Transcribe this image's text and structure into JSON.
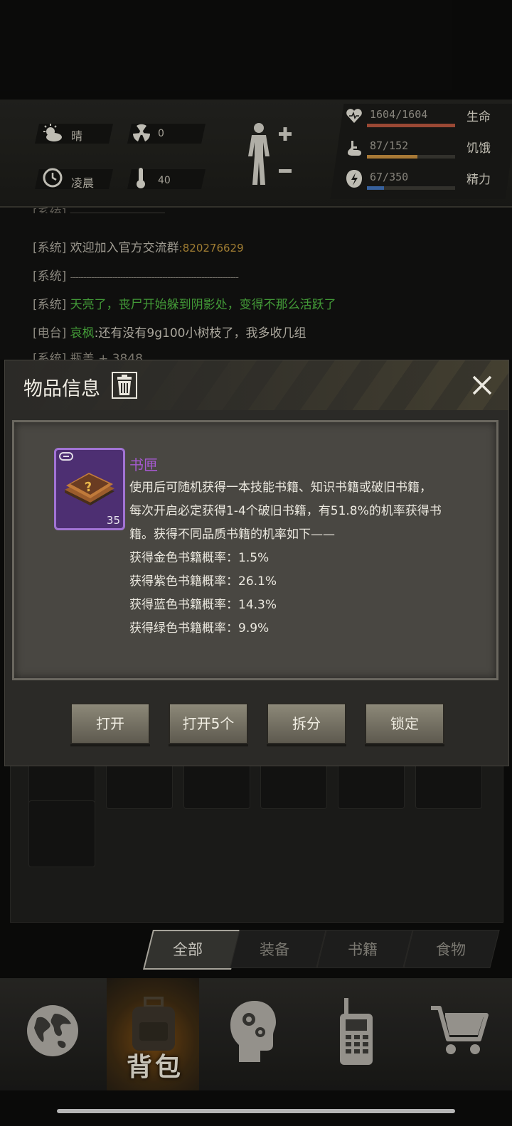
{
  "status": {
    "weather": "晴",
    "radiation": "0",
    "time_of_day": "凌晨",
    "temperature": "40",
    "stats": [
      {
        "label": "生命",
        "value": "1604/1604",
        "fill": 1.0,
        "color": "#b0533c"
      },
      {
        "label": "饥饿",
        "value": "87/152",
        "fill": 0.57,
        "color": "#c08a3e"
      },
      {
        "label": "精力",
        "value": "67/350",
        "fill": 0.19,
        "color": "#3f6fb3"
      }
    ]
  },
  "chat": [
    {
      "channel": "[系统]",
      "text": "欢迎加入官方交流群",
      "extra": ":820276629",
      "color": "#a9a59a",
      "extra_color": "#b78f3a"
    },
    {
      "channel": "[系统]",
      "text": "----------------------------------------------------------------",
      "extra": "",
      "color": "#8c897f",
      "extra_color": ""
    },
    {
      "channel": "[系统]",
      "text": "天亮了，丧尸开始躲到阴影处，变得不那么活跃了",
      "extra": "",
      "color": "#4caf3f",
      "extra_color": ""
    },
    {
      "channel": "[电台]",
      "speaker": "哀枫",
      "text": ":还有没有9g100小树枝了，我多收几组",
      "extra": "",
      "color": "#c3bfb3",
      "extra_color": ""
    }
  ],
  "chat_partial": "[系统] 瓶盖 + 3848",
  "dialog": {
    "title": "物品信息",
    "item": {
      "name": "书匣",
      "count": "35",
      "name_color": "#a55ad0",
      "desc_lines": [
        "使用后可随机获得一本技能书籍、知识书籍或破旧书籍，",
        "每次开启必定获得1-4个破旧书籍，有51.8%的机率获得书",
        "籍。获得不同品质书籍的机率如下——",
        "获得金色书籍概率：1.5%",
        "获得紫色书籍概率：26.1%",
        "获得蓝色书籍概率：14.3%",
        "获得绿色书籍概率：9.9%"
      ]
    },
    "buttons": [
      "打开",
      "打开5个",
      "拆分",
      "锁定"
    ]
  },
  "tabs": [
    "全部",
    "装备",
    "书籍",
    "食物"
  ],
  "nav": {
    "items": [
      "world-map",
      "backpack",
      "skills",
      "radio",
      "shop"
    ],
    "active_label": "背包"
  }
}
